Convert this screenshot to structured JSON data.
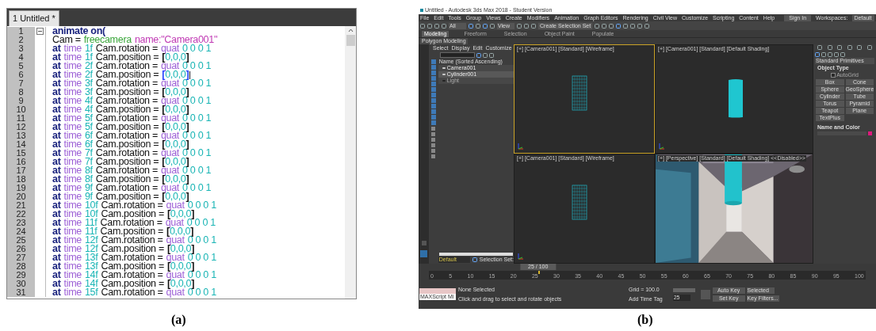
{
  "panel_a": {
    "tab": {
      "label": "1 Untitled *",
      "selected": true
    },
    "lines": [
      {
        "number": "1",
        "fold": true,
        "tokens": [
          {
            "kind": "keyword",
            "text": "animate on("
          }
        ]
      },
      {
        "number": "2",
        "tokens": [
          {
            "kind": "plain",
            "text": "Cam ="
          },
          {
            "kind": "constructor",
            "text": "freecamera"
          },
          {
            "kind": "string",
            "text": "name:\"Camera001\""
          }
        ]
      },
      {
        "number": "3",
        "tokens": [
          {
            "kind": "keyword",
            "text": "at"
          },
          {
            "kind": "builtin",
            "text": "time"
          },
          {
            "kind": "number",
            "text": "1f"
          },
          {
            "kind": "plain",
            "text": "Cam.rotation ="
          },
          {
            "kind": "function",
            "text": "quat"
          },
          {
            "kind": "number",
            "text": "0 0 0 1"
          }
        ]
      },
      {
        "number": "4",
        "tokens": [
          {
            "kind": "keyword",
            "text": "at"
          },
          {
            "kind": "builtin",
            "text": "time"
          },
          {
            "kind": "number",
            "text": "1f"
          },
          {
            "kind": "plain",
            "text": "Cam.position ="
          },
          {
            "kind": "bracket",
            "text": "["
          },
          {
            "kind": "number",
            "text": "0,0,0"
          },
          {
            "kind": "bracket",
            "text": "]"
          }
        ]
      },
      {
        "number": "5",
        "tokens": [
          {
            "kind": "keyword",
            "text": "at"
          },
          {
            "kind": "builtin",
            "text": "time"
          },
          {
            "kind": "number",
            "text": "2f"
          },
          {
            "kind": "plain",
            "text": "Cam.rotation ="
          },
          {
            "kind": "function",
            "text": "quat"
          },
          {
            "kind": "number",
            "text": "0 0 0 1"
          }
        ]
      },
      {
        "number": "6",
        "cursor": true,
        "tokens": [
          {
            "kind": "keyword",
            "text": "at"
          },
          {
            "kind": "builtin",
            "text": "time"
          },
          {
            "kind": "number",
            "text": "2f"
          },
          {
            "kind": "plain",
            "text": "Cam.position ="
          },
          {
            "kind": "bracket_match",
            "text": "["
          },
          {
            "kind": "number",
            "text": "0,0,0"
          },
          {
            "kind": "bracket_match",
            "text": "]"
          }
        ]
      },
      {
        "number": "7",
        "tokens": [
          {
            "kind": "keyword",
            "text": "at"
          },
          {
            "kind": "builtin",
            "text": "time"
          },
          {
            "kind": "number",
            "text": "3f"
          },
          {
            "kind": "plain",
            "text": "Cam.rotation ="
          },
          {
            "kind": "function",
            "text": "quat"
          },
          {
            "kind": "number",
            "text": "0 0 0 1"
          }
        ]
      },
      {
        "number": "8",
        "tokens": [
          {
            "kind": "keyword",
            "text": "at"
          },
          {
            "kind": "builtin",
            "text": "time"
          },
          {
            "kind": "number",
            "text": "3f"
          },
          {
            "kind": "plain",
            "text": "Cam.position ="
          },
          {
            "kind": "bracket",
            "text": "["
          },
          {
            "kind": "number",
            "text": "0,0,0"
          },
          {
            "kind": "bracket",
            "text": "]"
          }
        ]
      },
      {
        "number": "9",
        "tokens": [
          {
            "kind": "keyword",
            "text": "at"
          },
          {
            "kind": "builtin",
            "text": "time"
          },
          {
            "kind": "number",
            "text": "4f"
          },
          {
            "kind": "plain",
            "text": "Cam.rotation ="
          },
          {
            "kind": "function",
            "text": "quat"
          },
          {
            "kind": "number",
            "text": "0 0 0 1"
          }
        ]
      },
      {
        "number": "10",
        "tokens": [
          {
            "kind": "keyword",
            "text": "at"
          },
          {
            "kind": "builtin",
            "text": "time"
          },
          {
            "kind": "number",
            "text": "4f"
          },
          {
            "kind": "plain",
            "text": "Cam.position ="
          },
          {
            "kind": "bracket",
            "text": "["
          },
          {
            "kind": "number",
            "text": "0,0,0"
          },
          {
            "kind": "bracket",
            "text": "]"
          }
        ]
      },
      {
        "number": "11",
        "tokens": [
          {
            "kind": "keyword",
            "text": "at"
          },
          {
            "kind": "builtin",
            "text": "time"
          },
          {
            "kind": "number",
            "text": "5f"
          },
          {
            "kind": "plain",
            "text": "Cam.rotation ="
          },
          {
            "kind": "function",
            "text": "quat"
          },
          {
            "kind": "number",
            "text": "0 0 0 1"
          }
        ]
      },
      {
        "number": "12",
        "tokens": [
          {
            "kind": "keyword",
            "text": "at"
          },
          {
            "kind": "builtin",
            "text": "time"
          },
          {
            "kind": "number",
            "text": "5f"
          },
          {
            "kind": "plain",
            "text": "Cam.position ="
          },
          {
            "kind": "bracket",
            "text": "["
          },
          {
            "kind": "number",
            "text": "0,0,0"
          },
          {
            "kind": "bracket",
            "text": "]"
          }
        ]
      },
      {
        "number": "13",
        "tokens": [
          {
            "kind": "keyword",
            "text": "at"
          },
          {
            "kind": "builtin",
            "text": "time"
          },
          {
            "kind": "number",
            "text": "6f"
          },
          {
            "kind": "plain",
            "text": "Cam.rotation ="
          },
          {
            "kind": "function",
            "text": "quat"
          },
          {
            "kind": "number",
            "text": "0 0 0 1"
          }
        ]
      },
      {
        "number": "14",
        "tokens": [
          {
            "kind": "keyword",
            "text": "at"
          },
          {
            "kind": "builtin",
            "text": "time"
          },
          {
            "kind": "number",
            "text": "6f"
          },
          {
            "kind": "plain",
            "text": "Cam.position ="
          },
          {
            "kind": "bracket",
            "text": "["
          },
          {
            "kind": "number",
            "text": "0,0,0"
          },
          {
            "kind": "bracket",
            "text": "]"
          }
        ]
      },
      {
        "number": "15",
        "tokens": [
          {
            "kind": "keyword",
            "text": "at"
          },
          {
            "kind": "builtin",
            "text": "time"
          },
          {
            "kind": "number",
            "text": "7f"
          },
          {
            "kind": "plain",
            "text": "Cam.rotation ="
          },
          {
            "kind": "function",
            "text": "quat"
          },
          {
            "kind": "number",
            "text": "0 0 0 1"
          }
        ]
      },
      {
        "number": "16",
        "tokens": [
          {
            "kind": "keyword",
            "text": "at"
          },
          {
            "kind": "builtin",
            "text": "time"
          },
          {
            "kind": "number",
            "text": "7f"
          },
          {
            "kind": "plain",
            "text": "Cam.position ="
          },
          {
            "kind": "bracket",
            "text": "["
          },
          {
            "kind": "number",
            "text": "0,0,0"
          },
          {
            "kind": "bracket",
            "text": "]"
          }
        ]
      },
      {
        "number": "17",
        "tokens": [
          {
            "kind": "keyword",
            "text": "at"
          },
          {
            "kind": "builtin",
            "text": "time"
          },
          {
            "kind": "number",
            "text": "8f"
          },
          {
            "kind": "plain",
            "text": "Cam.rotation ="
          },
          {
            "kind": "function",
            "text": "quat"
          },
          {
            "kind": "number",
            "text": "0 0 0 1"
          }
        ]
      },
      {
        "number": "18",
        "tokens": [
          {
            "kind": "keyword",
            "text": "at"
          },
          {
            "kind": "builtin",
            "text": "time"
          },
          {
            "kind": "number",
            "text": "8f"
          },
          {
            "kind": "plain",
            "text": "Cam.position ="
          },
          {
            "kind": "bracket",
            "text": "["
          },
          {
            "kind": "number",
            "text": "0,0,0"
          },
          {
            "kind": "bracket",
            "text": "]"
          }
        ]
      },
      {
        "number": "19",
        "tokens": [
          {
            "kind": "keyword",
            "text": "at"
          },
          {
            "kind": "builtin",
            "text": "time"
          },
          {
            "kind": "number",
            "text": "9f"
          },
          {
            "kind": "plain",
            "text": "Cam.rotation ="
          },
          {
            "kind": "function",
            "text": "quat"
          },
          {
            "kind": "number",
            "text": "0 0 0 1"
          }
        ]
      },
      {
        "number": "20",
        "tokens": [
          {
            "kind": "keyword",
            "text": "at"
          },
          {
            "kind": "builtin",
            "text": "time"
          },
          {
            "kind": "number",
            "text": "9f"
          },
          {
            "kind": "plain",
            "text": "Cam.position ="
          },
          {
            "kind": "bracket",
            "text": "["
          },
          {
            "kind": "number",
            "text": "0,0,0"
          },
          {
            "kind": "bracket",
            "text": "]"
          }
        ]
      },
      {
        "number": "21",
        "tokens": [
          {
            "kind": "keyword",
            "text": "at"
          },
          {
            "kind": "builtin",
            "text": "time"
          },
          {
            "kind": "number",
            "text": "10f"
          },
          {
            "kind": "plain",
            "text": "Cam.rotation ="
          },
          {
            "kind": "function",
            "text": "quat"
          },
          {
            "kind": "number",
            "text": "0 0 0 1"
          }
        ]
      },
      {
        "number": "22",
        "tokens": [
          {
            "kind": "keyword",
            "text": "at"
          },
          {
            "kind": "builtin",
            "text": "time"
          },
          {
            "kind": "number",
            "text": "10f"
          },
          {
            "kind": "plain",
            "text": "Cam.position ="
          },
          {
            "kind": "bracket",
            "text": "["
          },
          {
            "kind": "number",
            "text": "0,0,0"
          },
          {
            "kind": "bracket",
            "text": "]"
          }
        ]
      },
      {
        "number": "23",
        "tokens": [
          {
            "kind": "keyword",
            "text": "at"
          },
          {
            "kind": "builtin",
            "text": "time"
          },
          {
            "kind": "number",
            "text": "11f"
          },
          {
            "kind": "plain",
            "text": "Cam.rotation ="
          },
          {
            "kind": "function",
            "text": "quat"
          },
          {
            "kind": "number",
            "text": "0 0 0 1"
          }
        ]
      },
      {
        "number": "24",
        "tokens": [
          {
            "kind": "keyword",
            "text": "at"
          },
          {
            "kind": "builtin",
            "text": "time"
          },
          {
            "kind": "number",
            "text": "11f"
          },
          {
            "kind": "plain",
            "text": "Cam.position ="
          },
          {
            "kind": "bracket",
            "text": "["
          },
          {
            "kind": "number",
            "text": "0,0,0"
          },
          {
            "kind": "bracket",
            "text": "]"
          }
        ]
      },
      {
        "number": "25",
        "tokens": [
          {
            "kind": "keyword",
            "text": "at"
          },
          {
            "kind": "builtin",
            "text": "time"
          },
          {
            "kind": "number",
            "text": "12f"
          },
          {
            "kind": "plain",
            "text": "Cam.rotation ="
          },
          {
            "kind": "function",
            "text": "quat"
          },
          {
            "kind": "number",
            "text": "0 0 0 1"
          }
        ]
      },
      {
        "number": "26",
        "tokens": [
          {
            "kind": "keyword",
            "text": "at"
          },
          {
            "kind": "builtin",
            "text": "time"
          },
          {
            "kind": "number",
            "text": "12f"
          },
          {
            "kind": "plain",
            "text": "Cam.position ="
          },
          {
            "kind": "bracket",
            "text": "["
          },
          {
            "kind": "number",
            "text": "0,0,0"
          },
          {
            "kind": "bracket",
            "text": "]"
          }
        ]
      },
      {
        "number": "27",
        "tokens": [
          {
            "kind": "keyword",
            "text": "at"
          },
          {
            "kind": "builtin",
            "text": "time"
          },
          {
            "kind": "number",
            "text": "13f"
          },
          {
            "kind": "plain",
            "text": "Cam.rotation ="
          },
          {
            "kind": "function",
            "text": "quat"
          },
          {
            "kind": "number",
            "text": "0 0 0 1"
          }
        ]
      },
      {
        "number": "28",
        "tokens": [
          {
            "kind": "keyword",
            "text": "at"
          },
          {
            "kind": "builtin",
            "text": "time"
          },
          {
            "kind": "number",
            "text": "13f"
          },
          {
            "kind": "plain",
            "text": "Cam.position ="
          },
          {
            "kind": "bracket",
            "text": "["
          },
          {
            "kind": "number",
            "text": "0,0,0"
          },
          {
            "kind": "bracket",
            "text": "]"
          }
        ]
      },
      {
        "number": "29",
        "tokens": [
          {
            "kind": "keyword",
            "text": "at"
          },
          {
            "kind": "builtin",
            "text": "time"
          },
          {
            "kind": "number",
            "text": "14f"
          },
          {
            "kind": "plain",
            "text": "Cam.rotation ="
          },
          {
            "kind": "function",
            "text": "quat"
          },
          {
            "kind": "number",
            "text": "0 0 0 1"
          }
        ]
      },
      {
        "number": "30",
        "tokens": [
          {
            "kind": "keyword",
            "text": "at"
          },
          {
            "kind": "builtin",
            "text": "time"
          },
          {
            "kind": "number",
            "text": "14f"
          },
          {
            "kind": "plain",
            "text": "Cam.position ="
          },
          {
            "kind": "bracket",
            "text": "["
          },
          {
            "kind": "number",
            "text": "0,0,0"
          },
          {
            "kind": "bracket",
            "text": "]"
          }
        ]
      },
      {
        "number": "31",
        "tokens": [
          {
            "kind": "keyword",
            "text": "at"
          },
          {
            "kind": "builtin",
            "text": "time"
          },
          {
            "kind": "number",
            "text": "15f"
          },
          {
            "kind": "plain",
            "text": "Cam.rotation ="
          },
          {
            "kind": "function",
            "text": "quat"
          },
          {
            "kind": "number",
            "text": "0 0 0 1"
          }
        ]
      }
    ]
  },
  "panel_b": {
    "window": {
      "title": "Untitled - Autodesk 3ds Max 2018 - Student Version"
    },
    "menu": [
      "File",
      "Edit",
      "Tools",
      "Group",
      "Views",
      "Create",
      "Modifiers",
      "Animation",
      "Graph Editors",
      "Rendering",
      "Civil View",
      "Customize",
      "Scripting",
      "Content",
      "Help"
    ],
    "sign_in": "Sign In",
    "workspaces_label": "Workspaces:",
    "workspace": "Default",
    "toolbar": {
      "filter": "All",
      "reference": "View",
      "selection_set": "Create Selection Set"
    },
    "ribbon_tabs": [
      {
        "label": "Modeling",
        "selected": true
      },
      {
        "label": "Freeform",
        "selected": false
      },
      {
        "label": "Selection",
        "selected": false
      },
      {
        "label": "Object Paint",
        "selected": false
      },
      {
        "label": "Populate",
        "selected": false
      }
    ],
    "ribbon_panel": "Polygon Modeling",
    "explorer": {
      "tabs": [
        "Select",
        "Display",
        "Edit",
        "Customize"
      ],
      "column": "Name (Sorted Ascending)",
      "items": [
        {
          "name": "Camera001",
          "visible": true,
          "selected": false
        },
        {
          "name": "Cylinder001",
          "visible": true,
          "selected": true
        },
        {
          "name": "Light",
          "visible": false,
          "selected": false
        }
      ],
      "layer": "Default",
      "selection_set": "Selection Set:"
    },
    "viewports": [
      {
        "label": "[+] [Camera001] [Standard] [Wireframe]",
        "kind": "wireframe",
        "active": true
      },
      {
        "label": "[+] [Camera001] [Standard] [Default Shading]",
        "kind": "shaded",
        "active": false
      },
      {
        "label": "[+] [Camera001] [Standard] [Wireframe]",
        "kind": "wireframe",
        "active": false
      },
      {
        "label": "[+] [Perspective] [Standard] [Default Shading] <<Disabled>>",
        "kind": "picture",
        "active": false
      }
    ],
    "command_panel": {
      "dropdown": "Standard Primitives",
      "object_type": "Object Type",
      "autogrid": {
        "label": "AutoGrid",
        "checked": false
      },
      "buttons": [
        "Box",
        "Cone",
        "Sphere",
        "GeoSphere",
        "Cylinder",
        "Tube",
        "Torus",
        "Pyramid",
        "Teapot",
        "Plane",
        "TextPlus"
      ],
      "name_and_color": "Name and Color",
      "color": "#e0197d"
    },
    "timeline": {
      "frame": "25 / 100",
      "level": 0.25,
      "ticks": [
        "0",
        "5",
        "10",
        "15",
        "20",
        "25",
        "30",
        "35",
        "40",
        "45",
        "50",
        "55",
        "60",
        "65",
        "70",
        "75",
        "80",
        "85",
        "90",
        "95",
        "100"
      ]
    },
    "status": {
      "maxscript": "MAXScript Mi",
      "selection": "None Selected",
      "prompt": "Click and drag to select and rotate objects",
      "grid": "Grid = 100.0",
      "add_time_tag": "Add Time Tag",
      "auto_key": "Auto Key",
      "key_mode": "Selected",
      "set_key": "Set Key",
      "key_filters": "Key Filters...",
      "frame": "25"
    }
  },
  "captions": [
    "(a)",
    "(b)"
  ]
}
